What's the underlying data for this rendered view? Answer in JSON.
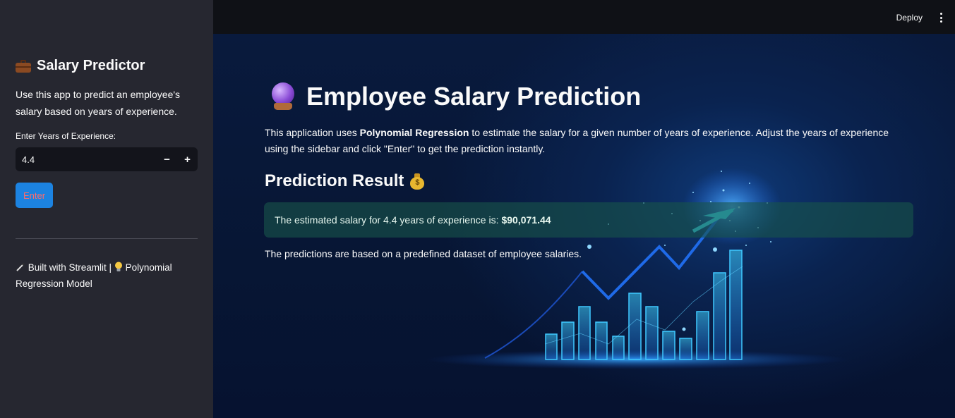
{
  "sidebar": {
    "title": "Salary Predictor",
    "title_icon": "briefcase-icon",
    "description": "Use this app to predict an employee's salary based on years of experience.",
    "input_label": "Enter Years of Experience:",
    "input_value": "4.4",
    "decrement": "−",
    "increment": "+",
    "enter_label": "Enter",
    "footer_part1": "Built with Streamlit |",
    "footer_part2": "Polynomial Regression Model",
    "footer_icons": [
      "magic-wand-icon",
      "lightbulb-icon"
    ]
  },
  "topbar": {
    "deploy_label": "Deploy",
    "menu_icon": "kebab-menu-icon"
  },
  "main": {
    "title": "Employee Salary Prediction",
    "title_icon": "crystal-ball-icon",
    "intro_prefix": "This application uses",
    "intro_bold": "Polynomial Regression",
    "intro_suffix": "to estimate the salary for a given number of years of experience. Adjust the years of experience using the sidebar and click \"Enter\" to get the prediction instantly.",
    "result_heading": "Prediction Result",
    "result_icon": "money-bag-icon",
    "result_prefix": "The estimated salary for 4.4 years of experience is:",
    "result_value": "$90,071.44",
    "note": "The predictions are based on a predefined dataset of employee salaries."
  },
  "colors": {
    "sidebar_bg": "#262730",
    "topbar_bg": "#0f1116",
    "main_bg": "#0a1a3c",
    "primary_button": "#1c83e1",
    "button_text": "#ff6b6b",
    "result_bg": "#18544a"
  }
}
